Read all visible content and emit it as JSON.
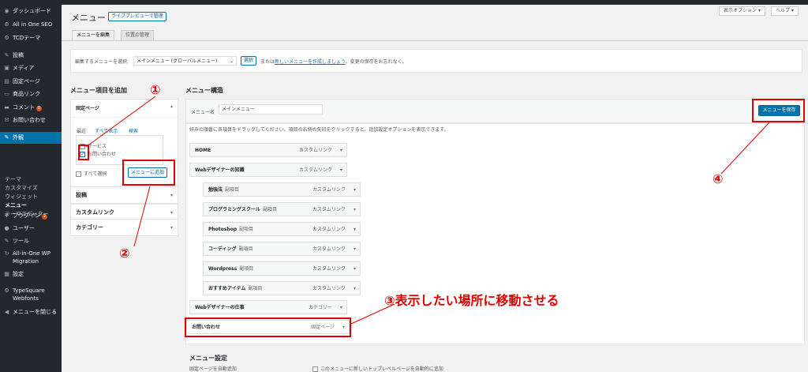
{
  "sidebar": {
    "items": [
      {
        "label": "ダッシュボード",
        "icon": "dashboard-icon",
        "glyph": "◉"
      },
      {
        "label": "All in One SEO",
        "icon": "seo-icon",
        "glyph": "⚙"
      },
      {
        "label": "TCDテーマ",
        "icon": "gear-icon",
        "glyph": "⚙"
      },
      {
        "label": "投稿",
        "icon": "pin-icon",
        "glyph": "✎"
      },
      {
        "label": "メディア",
        "icon": "media-icon",
        "glyph": "▣"
      },
      {
        "label": "固定ページ",
        "icon": "page-icon",
        "glyph": "▤"
      },
      {
        "label": "商品リンク",
        "icon": "link-icon",
        "glyph": "▭"
      },
      {
        "label": "コメント",
        "icon": "comment-icon",
        "glyph": "▬",
        "badge": "0"
      },
      {
        "label": "お問い合わせ",
        "icon": "mail-icon",
        "glyph": "✉"
      },
      {
        "label": "外観",
        "icon": "brush-icon",
        "glyph": "✎"
      }
    ],
    "appearance_sub": [
      "テーマ",
      "カスタマイズ",
      "ウィジェット",
      "メニュー",
      "テーマエディター"
    ],
    "items_bottom": [
      {
        "label": "プラグイン",
        "icon": "plugin-icon",
        "glyph": "✚",
        "badge": "2"
      },
      {
        "label": "ユーザー",
        "icon": "user-icon",
        "glyph": "●"
      },
      {
        "label": "ツール",
        "icon": "wrench-icon",
        "glyph": "✎"
      },
      {
        "label": "All-in-One WP Migration",
        "icon": "migration-icon",
        "glyph": "↻"
      },
      {
        "label": "設定",
        "icon": "settings-icon",
        "glyph": "▦"
      },
      {
        "label": "TypeSquare Webfonts",
        "icon": "font-icon",
        "glyph": "⚙"
      },
      {
        "label": "メニューを閉じる",
        "icon": "collapse-icon",
        "glyph": "◀"
      }
    ]
  },
  "header": {
    "title": "メニュー",
    "live_preview": "ライブプレビューで管理",
    "screen_options": "表示オプション ▾",
    "help": "ヘルプ ▾"
  },
  "tabs": [
    "メニューを編集",
    "位置の管理"
  ],
  "select_bar": {
    "label": "編集するメニューを選択:",
    "selected": "メインメニュー (グローバルメニュー)",
    "select_button": "選択",
    "or_text": "または",
    "create_link": "新しいメニューを作成しましょう",
    "after_text": "。変更の保存をお忘れなく。"
  },
  "left": {
    "heading": "メニュー項目を追加",
    "fixed_pages": "固定ページ",
    "subtabs": [
      "最近",
      "すべて表示",
      "検索"
    ],
    "pages": [
      {
        "label": "サービス",
        "checked": false
      },
      {
        "label": "お問い合わせ",
        "checked": true
      }
    ],
    "select_all": "すべて選択",
    "add_button": "メニューに追加",
    "sections": [
      "投稿",
      "カスタムリンク",
      "カテゴリー"
    ]
  },
  "right": {
    "heading": "メニュー構造",
    "name_label": "メニュー名",
    "name_value": "メインメニュー",
    "save_button": "メニューを保存",
    "instructions": "好みの順番に各項目をドラッグしてください。項目の右側の矢印をクリックすると、追加設定オプションを表示できます。",
    "items": [
      {
        "label": "HOME",
        "sub": "",
        "type": "カスタムリンク"
      },
      {
        "label": "Webデザイナーの知識",
        "sub": "",
        "type": "カスタムリンク"
      },
      {
        "label": "勉強法",
        "sub": "副項目",
        "type": "カスタムリンク"
      },
      {
        "label": "プログラミングスクール",
        "sub": "副項目",
        "type": "カスタムリンク"
      },
      {
        "label": "Photoshop",
        "sub": "副項目",
        "type": "カスタムリンク"
      },
      {
        "label": "コーディング",
        "sub": "副項目",
        "type": "カスタムリンク"
      },
      {
        "label": "Wordpress",
        "sub": "副項目",
        "type": "カスタムリンク"
      },
      {
        "label": "おすすめアイテム",
        "sub": "副項目",
        "type": "カスタムリンク"
      },
      {
        "label": "Webデザイナーの仕事",
        "sub": "",
        "type": "カテゴリー"
      },
      {
        "label": "お問い合わせ",
        "sub": "",
        "type": "固定ページ"
      }
    ],
    "settings_heading": "メニュー設定",
    "auto_add_label": "固定ページを自動追加",
    "auto_add_option": "このメニューに新しいトップレベルページを自動的に追加"
  },
  "annotations": {
    "n1": "①",
    "n2": "②",
    "n3": "③表示したい場所に移動させる",
    "n4": "④",
    "color": "#e00000"
  }
}
